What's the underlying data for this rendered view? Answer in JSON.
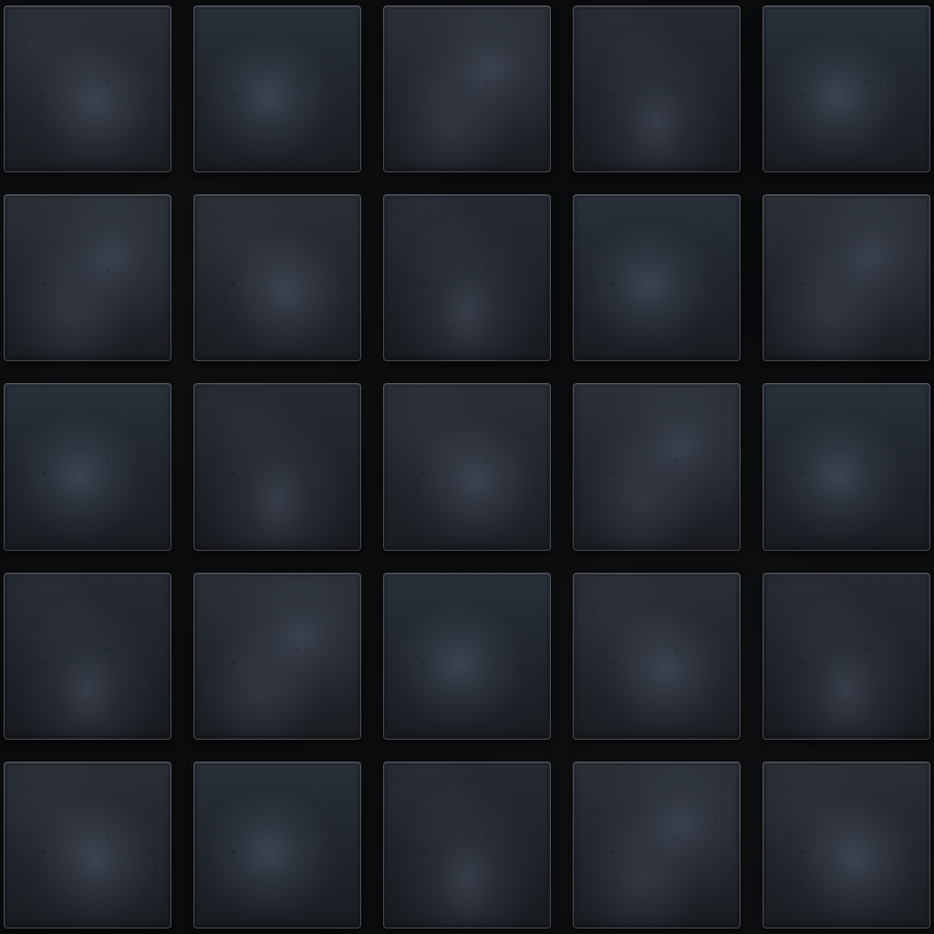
{
  "scene": {
    "subject": "",
    "rows": 5,
    "columns": 5,
    "colors": {
      "grout": "#0b0c0d",
      "tile_base": "#22272d",
      "tile_highlight": "#4f5870",
      "edge_highlight": "#a0a8b0"
    }
  }
}
